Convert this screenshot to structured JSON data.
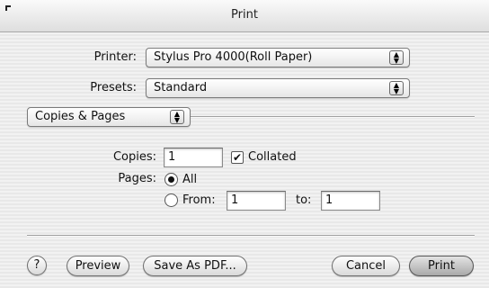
{
  "window": {
    "title": "Print"
  },
  "printer": {
    "label": "Printer:",
    "value": "Stylus Pro 4000(Roll Paper)"
  },
  "presets": {
    "label": "Presets:",
    "value": "Standard"
  },
  "panel": {
    "value": "Copies & Pages"
  },
  "copies": {
    "label": "Copies:",
    "value": "1",
    "collated_label": "Collated",
    "collated_checked": true
  },
  "pages": {
    "label": "Pages:",
    "all_label": "All",
    "from_label": "From:",
    "from_value": "1",
    "to_label": "to:",
    "to_value": "1",
    "selected": "All"
  },
  "buttons": {
    "help": "?",
    "preview": "Preview",
    "save_pdf": "Save As PDF...",
    "cancel": "Cancel",
    "print": "Print"
  },
  "icons": {
    "popup_arrows": "up-down-arrows-icon",
    "help": "question-mark-icon"
  }
}
